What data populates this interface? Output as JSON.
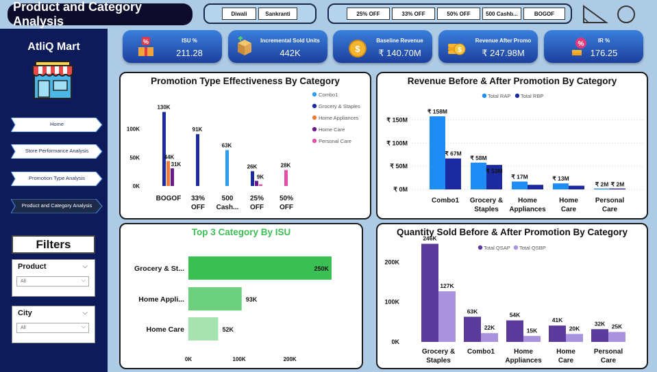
{
  "header": {
    "title": "Product and Category Analysis",
    "festival_options": [
      "Diwali",
      "Sankranti"
    ],
    "promo_options": [
      "25% OFF",
      "33% OFF",
      "50% OFF",
      "500 Cashb...",
      "BOGOF"
    ]
  },
  "kpis": [
    {
      "label": "ISU %",
      "value": "211.28",
      "icon": "percent-gift-icon"
    },
    {
      "label": "Incremental Sold Units",
      "value": "442K",
      "icon": "box-icon"
    },
    {
      "label": "Baseline Revenue",
      "value": "₹ 140.70M",
      "icon": "coin-icon"
    },
    {
      "label": "Revenue After Promo",
      "value": "₹ 247.98M",
      "icon": "coin-stack-icon"
    },
    {
      "label": "IR %",
      "value": "176.25",
      "icon": "percent-money-icon"
    }
  ],
  "sidebar": {
    "brand": "AtliQ Mart",
    "nav": [
      {
        "label": "Home"
      },
      {
        "label": "Store Performance Analysis"
      },
      {
        "label": "Promotion Type Analysis"
      },
      {
        "label": "Product and Category Analysis",
        "active": true
      }
    ],
    "filters_title": "Filters",
    "filters": [
      {
        "label": "Product",
        "value": "All"
      },
      {
        "label": "City",
        "value": "All"
      }
    ]
  },
  "colors": {
    "combo1": "#2c9cf2",
    "grocery": "#1b2a9e",
    "home_appliances": "#f07c3c",
    "home_care": "#6a1a8a",
    "personal_care": "#e24fa7",
    "rap": "#1e8cf5",
    "rbp": "#1b2a9e",
    "qsap": "#5a3a9a",
    "qsbp": "#a993de",
    "isu_bars": [
      "#3cbf54",
      "#6dd07f",
      "#a7e3b1"
    ]
  },
  "chart_data": [
    {
      "type": "bar",
      "title": "Promotion Type Effectiveness By Category",
      "categories": [
        "BOGOF",
        "33% OFF",
        "500 Cash...",
        "25% OFF",
        "50% OFF"
      ],
      "series": [
        {
          "name": "Combo1",
          "values": [
            null,
            null,
            63,
            null,
            null
          ]
        },
        {
          "name": "Grocery & Staples",
          "values": [
            130,
            91,
            null,
            26,
            null
          ]
        },
        {
          "name": "Home Appliances",
          "values": [
            44,
            null,
            null,
            null,
            null
          ]
        },
        {
          "name": "Home Care",
          "values": [
            31,
            null,
            null,
            9,
            null
          ]
        },
        {
          "name": "Personal Care",
          "values": [
            null,
            null,
            null,
            3,
            28
          ]
        }
      ],
      "value_labels": [
        {
          "category": "BOGOF",
          "series": "Grocery & Staples",
          "text": "130K"
        },
        {
          "category": "BOGOF",
          "series": "Home Appliances",
          "text": "44K"
        },
        {
          "category": "BOGOF",
          "series": "Home Care",
          "text": "31K"
        },
        {
          "category": "33% OFF",
          "series": "Grocery & Staples",
          "text": "91K"
        },
        {
          "category": "500 Cash...",
          "series": "Combo1",
          "text": "63K"
        },
        {
          "category": "25% OFF",
          "series": "Grocery & Staples",
          "text": "26K"
        },
        {
          "category": "25% OFF",
          "series": "Home Care",
          "text": "9K"
        },
        {
          "category": "50% OFF",
          "series": "Personal Care",
          "text": "28K"
        }
      ],
      "yticks": [
        "0K",
        "50K",
        "100K"
      ],
      "ylim": [
        0,
        150
      ],
      "legend": "right"
    },
    {
      "type": "bar",
      "title": "Revenue Before & After Promotion By Category",
      "categories": [
        "Combo1",
        "Grocery & Staples",
        "Home Appliances",
        "Home Care",
        "Personal Care"
      ],
      "series": [
        {
          "name": "Total RAP",
          "values": [
            158,
            58,
            17,
            13,
            2
          ],
          "labels": [
            "₹ 158M",
            "₹ 58M",
            "₹ 17M",
            "₹ 13M",
            "₹ 2M"
          ]
        },
        {
          "name": "Total RBP",
          "values": [
            67,
            53,
            10,
            8,
            2
          ],
          "labels": [
            "₹ 67M",
            "₹ 53M",
            "",
            "",
            "₹ 2M"
          ]
        }
      ],
      "yticks": [
        "₹ 0M",
        "₹ 50M",
        "₹ 100M",
        "₹ 150M"
      ],
      "ylim": [
        0,
        170
      ],
      "legend": "top"
    },
    {
      "type": "bar",
      "orientation": "horizontal",
      "title": "Top 3 Category By ISU",
      "categories": [
        "Grocery & St...",
        "Home Appli...",
        "Home Care"
      ],
      "values": [
        250,
        93,
        52
      ],
      "labels": [
        "250K",
        "93K",
        "52K"
      ],
      "xticks": [
        "0K",
        "100K",
        "200K"
      ],
      "xlim": [
        0,
        270
      ]
    },
    {
      "type": "bar",
      "title": "Quantity Sold Before & After Promotion By Category",
      "categories": [
        "Grocery & Staples",
        "Combo1",
        "Home Appliances",
        "Home Care",
        "Personal Care"
      ],
      "series": [
        {
          "name": "Total QSAP",
          "values": [
            246,
            63,
            54,
            41,
            32
          ],
          "labels": [
            "246K",
            "63K",
            "54K",
            "41K",
            "32K"
          ]
        },
        {
          "name": "Total QSBP",
          "values": [
            127,
            22,
            15,
            20,
            25
          ],
          "labels": [
            "127K",
            "22K",
            "15K",
            "20K",
            "25K"
          ]
        }
      ],
      "yticks": [
        "0K",
        "100K",
        "200K"
      ],
      "ylim": [
        0,
        270
      ],
      "legend": "top"
    }
  ]
}
